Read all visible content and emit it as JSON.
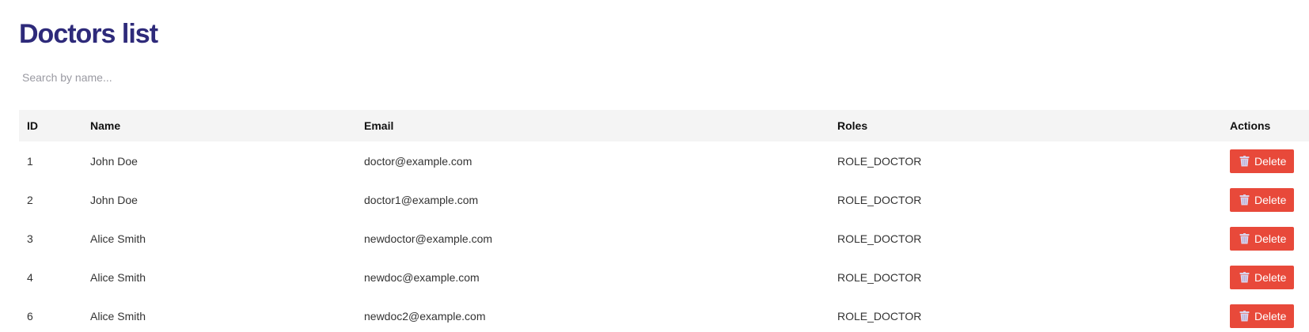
{
  "page": {
    "title": "Doctors list"
  },
  "search": {
    "placeholder": "Search by name...",
    "value": ""
  },
  "table": {
    "headers": {
      "id": "ID",
      "name": "Name",
      "email": "Email",
      "roles": "Roles",
      "actions": "Actions"
    },
    "rows": [
      {
        "id": "1",
        "name": "John Doe",
        "email": "doctor@example.com",
        "roles": "ROLE_DOCTOR",
        "action_label": "Delete"
      },
      {
        "id": "2",
        "name": "John Doe",
        "email": "doctor1@example.com",
        "roles": "ROLE_DOCTOR",
        "action_label": "Delete"
      },
      {
        "id": "3",
        "name": "Alice Smith",
        "email": "newdoctor@example.com",
        "roles": "ROLE_DOCTOR",
        "action_label": "Delete"
      },
      {
        "id": "4",
        "name": "Alice Smith",
        "email": "newdoc@example.com",
        "roles": "ROLE_DOCTOR",
        "action_label": "Delete"
      },
      {
        "id": "6",
        "name": "Alice Smith",
        "email": "newdoc2@example.com",
        "roles": "ROLE_DOCTOR",
        "action_label": "Delete"
      }
    ]
  },
  "icons": {
    "delete": "trash-icon"
  },
  "colors": {
    "title": "#2e2a7a",
    "delete_button": "#e8493a",
    "header_background": "#f4f4f4"
  }
}
